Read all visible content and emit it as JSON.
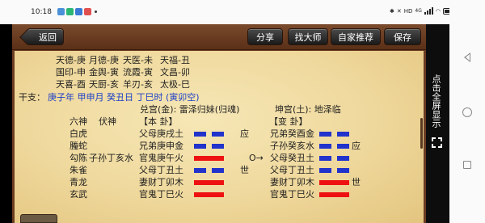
{
  "status_bar": {
    "time": "10:18",
    "notification_app_colors": [
      "#4a90d9",
      "#2bb673",
      "#3a7bd5",
      "#e05050"
    ],
    "network": "HD",
    "signal_badge": "4G"
  },
  "toolbar": {
    "back": "返回",
    "share": "分享",
    "find_master": "找大师",
    "recommend": "自家推荐",
    "save": "保存"
  },
  "shensha": [
    [
      "天德-庚",
      "月德-庚",
      "天医-未",
      "天福-丑"
    ],
    [
      "国印-申",
      "金舆-寅",
      "流霞-寅",
      "文昌-卯"
    ],
    [
      "天喜-酉",
      "天厨-亥",
      "羊刃-亥",
      "太极-巳"
    ]
  ],
  "ganzhi": {
    "label": "干支：",
    "value": "庚子年 甲申月 癸丑日 丁巳时 (寅卯空)"
  },
  "palace": {
    "main": "兑宫(金):  雷泽归妹(归魂)",
    "changed": "坤宫(土):  地泽临"
  },
  "headers": {
    "liushen": "六神",
    "fushen": "伏神",
    "main_gua": "【本  卦】",
    "changed_gua": "【变  卦】"
  },
  "lines": [
    {
      "liushen": "白虎",
      "fushen": "",
      "main_line": "父母庚戌土",
      "main_yin": true,
      "main_mark": "应",
      "moving": "",
      "changed_line": "兄弟癸酉金",
      "changed_yin": true,
      "changed_mark": ""
    },
    {
      "liushen": "螣蛇",
      "fushen": "",
      "main_line": "兄弟庚申金",
      "main_yin": true,
      "main_mark": "",
      "moving": "",
      "changed_line": "子孙癸亥水",
      "changed_yin": true,
      "changed_mark": "应"
    },
    {
      "liushen": "勾陈",
      "fushen": "子孙丁亥水",
      "main_line": "官鬼庚午火",
      "main_yin": false,
      "main_mark": "",
      "moving": "O→",
      "changed_line": "父母癸丑土",
      "changed_yin": true,
      "changed_mark": ""
    },
    {
      "liushen": "朱雀",
      "fushen": "",
      "main_line": "父母丁丑土",
      "main_yin": true,
      "main_mark": "世",
      "moving": "",
      "changed_line": "父母丁丑土",
      "changed_yin": true,
      "changed_mark": ""
    },
    {
      "liushen": "青龙",
      "fushen": "",
      "main_line": "妻财丁卯木",
      "main_yin": false,
      "main_mark": "",
      "moving": "",
      "changed_line": "妻财丁卯木",
      "changed_yin": false,
      "changed_mark": "世"
    },
    {
      "liushen": "玄武",
      "fushen": "",
      "main_line": "官鬼丁巳火",
      "main_yin": false,
      "main_mark": "",
      "moving": "",
      "changed_line": "官鬼丁巳火",
      "changed_yin": false,
      "changed_mark": ""
    }
  ],
  "side_panel": {
    "text": "点击全屏显示",
    "icon": "fullscreen-icon"
  },
  "colors": {
    "yin_bar": "#2233cc",
    "yang_bar": "#ee1111",
    "accent_blue": "#1a3ec8",
    "frame_brown": "#6b3c22"
  },
  "android_nav": {
    "icons": [
      "back-icon",
      "home-icon",
      "recents-icon"
    ]
  }
}
